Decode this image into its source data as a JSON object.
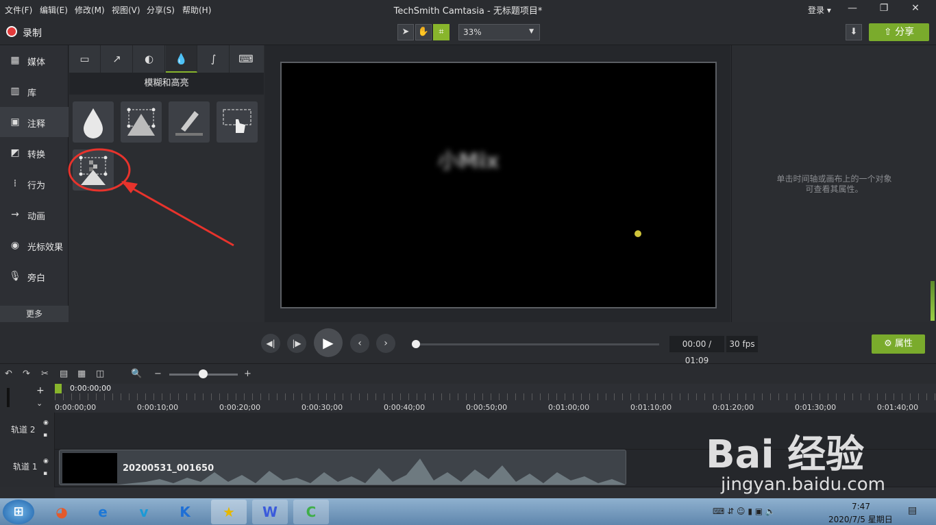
{
  "menu": [
    "文件(F)",
    "编辑(E)",
    "修改(M)",
    "视图(V)",
    "分享(S)",
    "帮助(H)"
  ],
  "app_title": "TechSmith Camtasia - 无标题项目*",
  "login": "登录 ▾",
  "toolbar": {
    "record_label": "录制",
    "zoom": "33%",
    "share_label": "分享"
  },
  "leftnav": {
    "items": [
      {
        "label": "媒体",
        "icon": "film-icon"
      },
      {
        "label": "库",
        "icon": "library-icon"
      },
      {
        "label": "注释",
        "icon": "annotation-icon"
      },
      {
        "label": "转换",
        "icon": "transition-icon"
      },
      {
        "label": "行为",
        "icon": "behavior-icon"
      },
      {
        "label": "动画",
        "icon": "animation-icon"
      },
      {
        "label": "光标效果",
        "icon": "cursor-effect-icon"
      },
      {
        "label": "旁白",
        "icon": "microphone-icon"
      }
    ],
    "more": "更多"
  },
  "annotations": {
    "heading": "模糊和高亮"
  },
  "canvas": {
    "blur_text": "小Mix"
  },
  "props_hint": {
    "line1": "单击时间轴或画布上的一个对象",
    "line2": "可查看其属性。"
  },
  "playback": {
    "timecode": "00:00 / 01:09",
    "fps": "30 fps",
    "props_label": "属性"
  },
  "timeline": {
    "playhead": "0:00:00;00",
    "ticks": [
      "0:00:00;00",
      "0:00:10;00",
      "0:00:20;00",
      "0:00:30;00",
      "0:00:40;00",
      "0:00:50;00",
      "0:01:00;00",
      "0:01:10;00",
      "0:01:20;00",
      "0:01:30;00",
      "0:01:40;00"
    ],
    "tracks": [
      {
        "label": "轨道 2"
      },
      {
        "label": "轨道 1"
      }
    ],
    "clip_title": "20200531_001650"
  },
  "taskbar": {
    "time": "7:47",
    "date": "2020/7/5 星期日"
  },
  "watermark": {
    "brand": "Bai 经验",
    "url": "jingyan.baidu.com"
  },
  "colors": {
    "accent": "#88b52c",
    "record": "#e23b3b",
    "annotation_circle": "#e8332c"
  }
}
